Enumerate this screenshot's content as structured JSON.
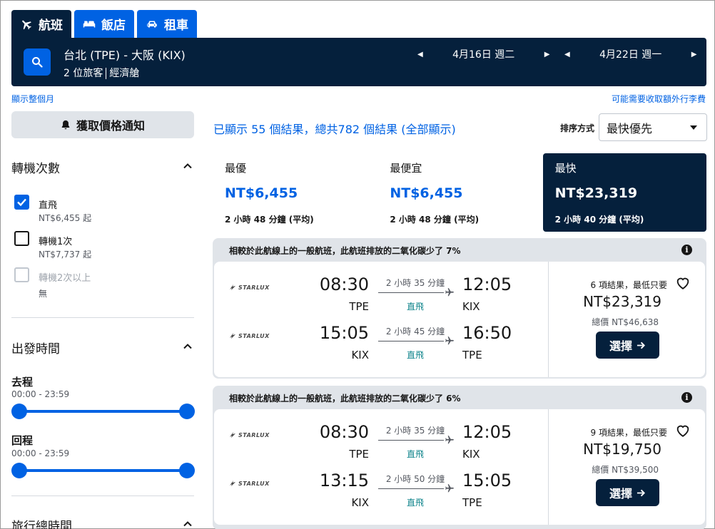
{
  "tabs": [
    {
      "label": "航班",
      "icon": "plane-icon"
    },
    {
      "label": "飯店",
      "icon": "bed-icon"
    },
    {
      "label": "租車",
      "icon": "car-icon"
    }
  ],
  "search": {
    "route": "台北 (TPE) - 大阪 (KIX)",
    "travellers": "2 位旅客",
    "cabin": "經濟艙",
    "depart_date": "4月16日 週二",
    "return_date": "4月22日 週一"
  },
  "links": {
    "whole_month": "顯示整個月",
    "baggage": "可能需要收取額外行李費"
  },
  "sidebar": {
    "alert_label": "獲取價格通知",
    "stops": {
      "title": "轉機次數",
      "options": [
        {
          "label": "直飛",
          "sub": "NT$6,455 起",
          "checked": true,
          "disabled": false
        },
        {
          "label": "轉機1次",
          "sub": "NT$7,737 起",
          "checked": false,
          "disabled": false
        },
        {
          "label": "轉機2次以上",
          "sub": "無",
          "checked": false,
          "disabled": true
        }
      ]
    },
    "departure_times": {
      "title": "出發時間",
      "outbound_label": "去程",
      "outbound_range": "00:00 - 23:59",
      "return_label": "回程",
      "return_range": "00:00 - 23:59"
    },
    "journey_duration": {
      "title": "旅行總時間"
    }
  },
  "results": {
    "count_text": "已顯示 55 個結果，總共782 個結果 (全部顯示)",
    "sort_label": "排序方式",
    "sort_value": "最快優先"
  },
  "summary_tabs": [
    {
      "label": "最優",
      "price": "NT$6,455",
      "duration": "2 小時 48 分鐘 (平均)",
      "active": false
    },
    {
      "label": "最便宜",
      "price": "NT$6,455",
      "duration": "2 小時 48 分鐘 (平均)",
      "active": false
    },
    {
      "label": "最快",
      "price": "NT$23,319",
      "duration": "2 小時 40 分鐘 (平均)",
      "active": true
    }
  ],
  "cards": [
    {
      "eco_note": "相較於此航線上的一般航班，此航班排放的二氧化碳少了 7%",
      "legs": [
        {
          "airline": "STARLUX",
          "dep_time": "08:30",
          "dep_code": "TPE",
          "duration": "2 小時 35 分鐘",
          "stops": "直飛",
          "arr_time": "12:05",
          "arr_code": "KIX"
        },
        {
          "airline": "STARLUX",
          "dep_time": "15:05",
          "dep_code": "KIX",
          "duration": "2 小時 45 分鐘",
          "stops": "直飛",
          "arr_time": "16:50",
          "arr_code": "TPE"
        }
      ],
      "deals": "6 項結果，最低只要",
      "price": "NT$23,319",
      "total": "總價 NT$46,638",
      "select_label": "選擇"
    },
    {
      "eco_note": "相較於此航線上的一般航班，此航班排放的二氧化碳少了 6%",
      "legs": [
        {
          "airline": "STARLUX",
          "dep_time": "08:30",
          "dep_code": "TPE",
          "duration": "2 小時 35 分鐘",
          "stops": "直飛",
          "arr_time": "12:05",
          "arr_code": "KIX"
        },
        {
          "airline": "STARLUX",
          "dep_time": "13:15",
          "dep_code": "KIX",
          "duration": "2 小時 50 分鐘",
          "stops": "直飛",
          "arr_time": "15:05",
          "arr_code": "TPE"
        }
      ],
      "deals": "9 項結果，最低只要",
      "price": "NT$19,750",
      "total": "總價 NT$39,500",
      "select_label": "選擇"
    }
  ],
  "colors": {
    "brand_blue": "#0062e3",
    "navy": "#05203c",
    "eco_green": "#0c838a"
  }
}
